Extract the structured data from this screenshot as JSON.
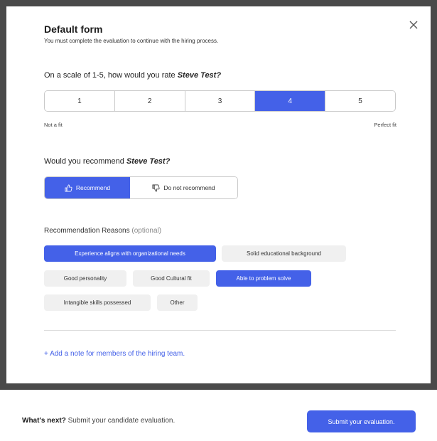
{
  "modal": {
    "title": "Default form",
    "subtitle": "You must complete the evaluation to continue with the hiring process.",
    "close_icon": "close-icon"
  },
  "rating": {
    "question_prefix": "On a scale of 1-5, how would you rate ",
    "candidate": "Steve Test?",
    "options": [
      "1",
      "2",
      "3",
      "4",
      "5"
    ],
    "selected": "4",
    "low_label": "Not a fit",
    "high_label": "Perfect fit"
  },
  "recommend": {
    "question_prefix": "Would you recommend ",
    "candidate": "Steve Test?",
    "recommend_label": "Recommend",
    "not_recommend_label": "Do not recommend",
    "recommend_icon": "thumbs-up-icon",
    "not_recommend_icon": "thumbs-down-icon",
    "selected": "Recommend"
  },
  "reasons": {
    "label": "Recommendation Reasons",
    "optional": "(optional)",
    "chips": [
      {
        "label": "Experience aligns with organizational needs",
        "selected": true
      },
      {
        "label": "Solid educational background",
        "selected": false
      },
      {
        "label": "Good personality",
        "selected": false
      },
      {
        "label": "Good Cultural fit",
        "selected": false
      },
      {
        "label": "Able to problem solve",
        "selected": true
      },
      {
        "label": "Intangible skills possessed",
        "selected": false
      },
      {
        "label": "Other",
        "selected": false
      }
    ]
  },
  "note": {
    "add_label": "+ Add a note for members of the hiring team."
  },
  "footer": {
    "whats_next": "What's next?",
    "whats_next_text": " Submit your candidate evaluation.",
    "submit_label": "Submit your evaluation."
  },
  "colors": {
    "accent": "#4461e8",
    "chip_bg": "#f0f0f0",
    "backdrop": "#4a4a4a"
  }
}
